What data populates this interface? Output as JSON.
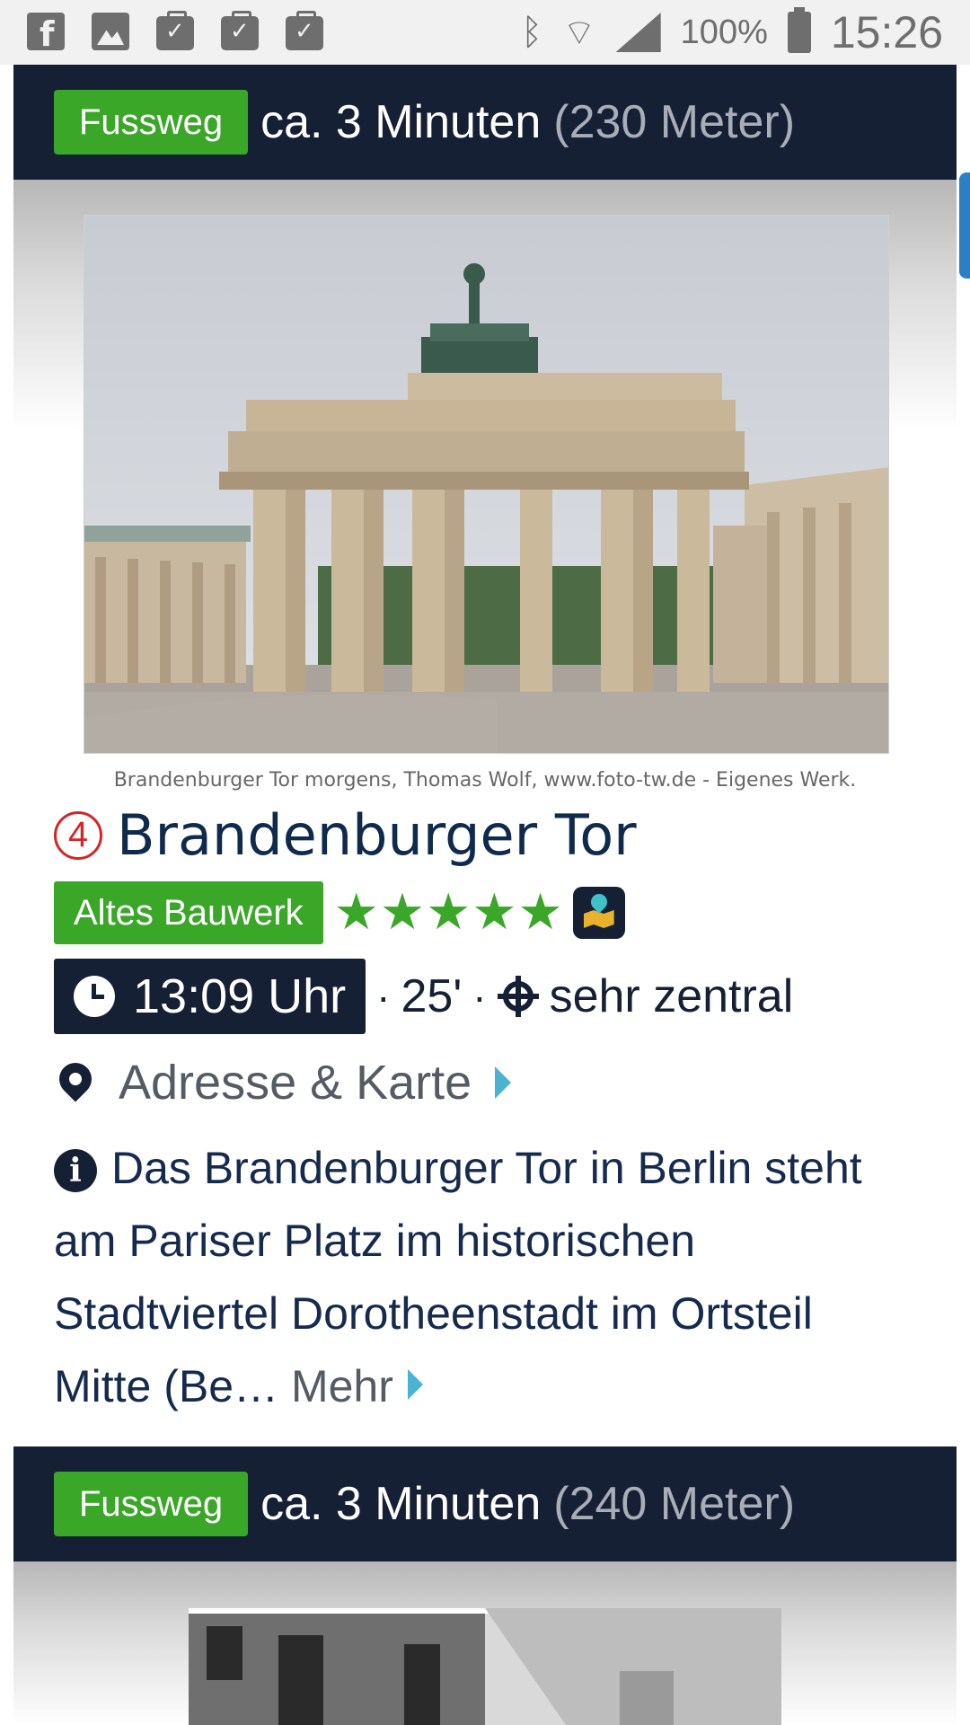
{
  "status_bar": {
    "battery_percent": "100%",
    "time": "15:26",
    "left_icons": [
      "facebook-icon",
      "image-icon",
      "briefcase-check-icon",
      "briefcase-check-icon",
      "briefcase-check-icon"
    ],
    "right_icons": [
      "bluetooth-icon",
      "wifi-icon",
      "signal-icon",
      "battery-icon"
    ]
  },
  "route_1": {
    "mode": "Fussweg",
    "duration": "ca. 3 Minuten",
    "distance": "(230 Meter)"
  },
  "poi": {
    "photo_caption": "Brandenburger Tor morgens, Thomas Wolf, www.foto-tw.de - Eigenes Werk.",
    "number": "4",
    "title": "Brandenburger Tor",
    "category": "Altes Bauwerk",
    "rating_stars": 5,
    "stars": [
      "★",
      "★",
      "★",
      "★",
      "★"
    ],
    "time": "13:09 Uhr",
    "dot": "·",
    "duration": "25'",
    "location": "sehr zentral",
    "address_link": "Adresse & Karte",
    "description": "Das Brandenburger Tor in Berlin steht am Pariser Platz im historischen Stadtviertel Dorotheenstadt im Ortsteil Mitte (Be…",
    "more_link": "Mehr"
  },
  "route_2": {
    "mode": "Fussweg",
    "duration": "ca. 3 Minuten",
    "distance": "(240 Meter)"
  },
  "colors": {
    "navy": "#152035",
    "green": "#3aa728",
    "red": "#d42626",
    "link_triangle": "#4ab3d1"
  }
}
